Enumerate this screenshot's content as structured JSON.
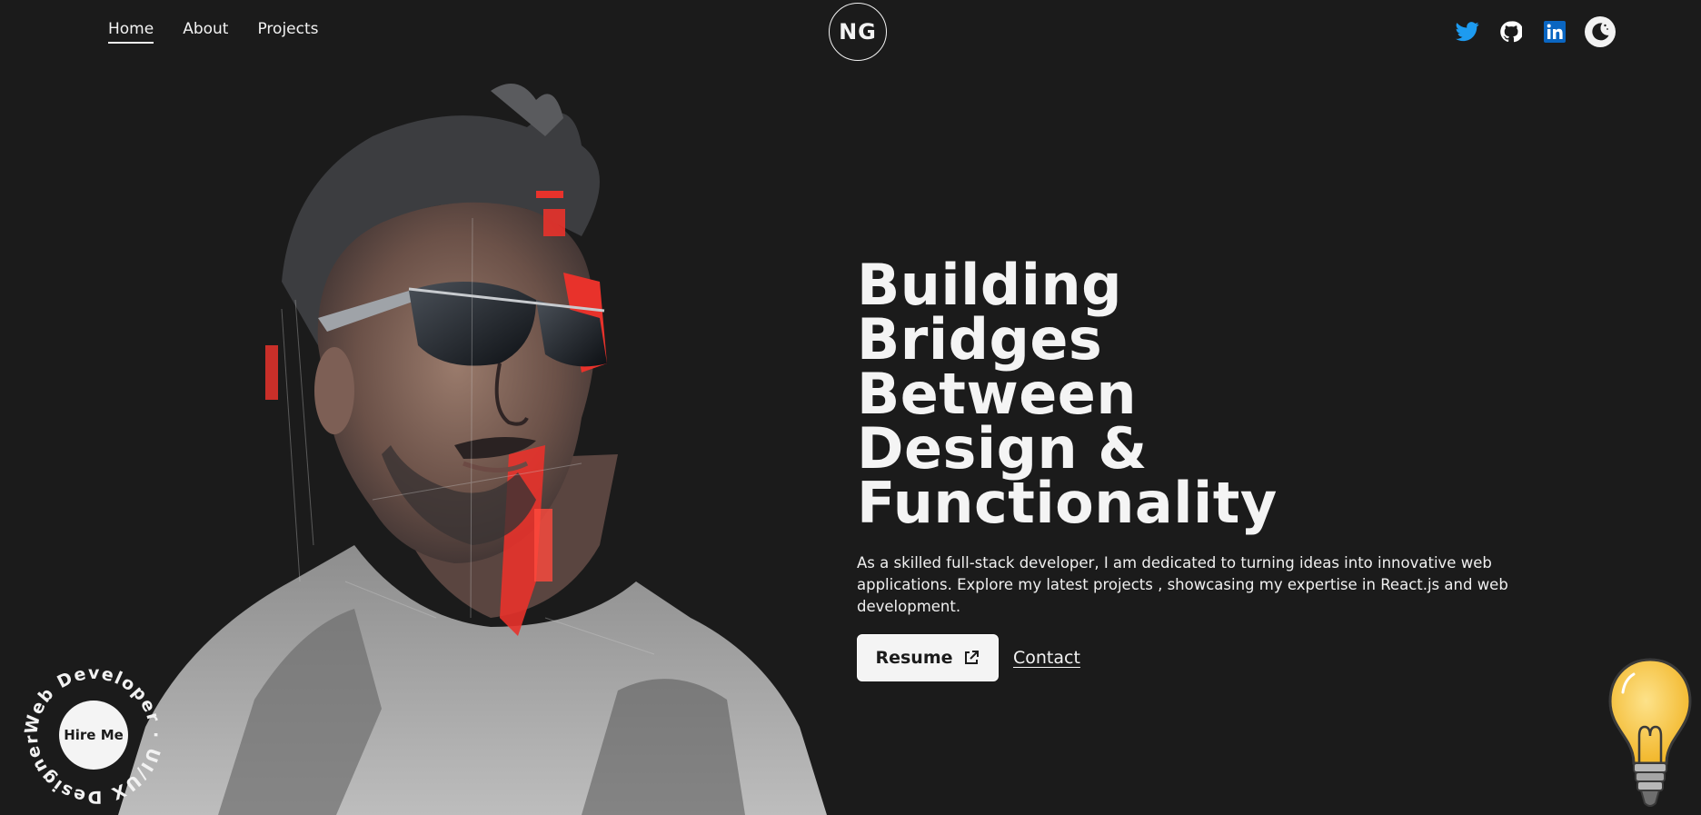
{
  "header": {
    "nav": [
      {
        "label": "Home",
        "active": true
      },
      {
        "label": "About",
        "active": false
      },
      {
        "label": "Projects",
        "active": false
      }
    ],
    "logo": "NG",
    "socials": [
      {
        "icon": "twitter-icon",
        "color": "#1d9bf0"
      },
      {
        "icon": "github-icon",
        "color": "#ffffff"
      },
      {
        "icon": "linkedin-icon",
        "color": "#0a66c2"
      },
      {
        "icon": "moon-icon",
        "color": "#f2f2f2"
      }
    ]
  },
  "hero": {
    "headline": [
      "Building",
      "Bridges",
      "Between",
      "Design &",
      "Functionality"
    ],
    "description": "As a skilled full-stack developer, I am dedicated to turning ideas into innovative web applications. Explore my latest projects , showcasing my expertise in React.js and web development.",
    "resume_label": "Resume",
    "contact_label": "Contact"
  },
  "hire_badge": {
    "button_label": "Hire Me",
    "ring_text": "Web Developer · UI/UX Designer ·"
  },
  "colors": {
    "background": "#1b1b1b",
    "text": "#f2f2f2",
    "accent_red": "#e8322b",
    "bulb_yellow": "#f7c948"
  }
}
